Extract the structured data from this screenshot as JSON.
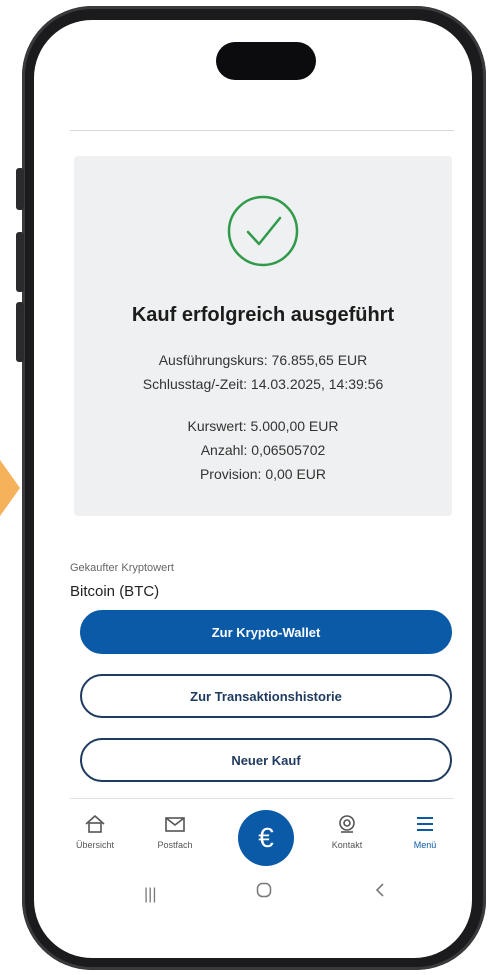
{
  "success": {
    "title": "Kauf erfolgreich ausgeführt",
    "execution_rate": "Ausführungskurs: 76.855,65 EUR",
    "close_date": "Schlusstag/-Zeit: 14.03.2025, 14:39:56",
    "market_value": "Kurswert: 5.000,00 EUR",
    "quantity": "Anzahl: 0,06505702",
    "commission": "Provision: 0,00 EUR"
  },
  "asset": {
    "label": "Gekaufter Kryptowert",
    "value": "Bitcoin (BTC)"
  },
  "buttons": {
    "wallet": "Zur Krypto-Wallet",
    "history": "Zur Transaktionshistorie",
    "new_purchase": "Neuer Kauf"
  },
  "tabbar": {
    "overview": "Übersicht",
    "inbox": "Postfach",
    "center_icon": "€",
    "contact": "Kontakt",
    "menu": "Menü"
  },
  "colors": {
    "primary": "#0a5aa8",
    "success_green": "#2f9a4a",
    "arrow_accent": "#f6b15b"
  }
}
